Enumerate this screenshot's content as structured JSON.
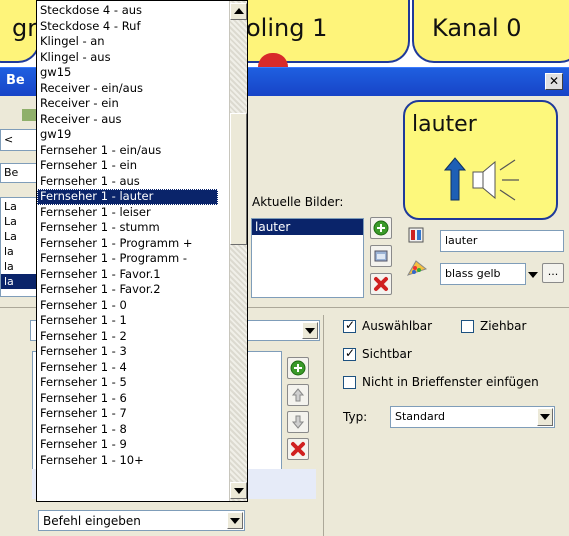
{
  "top_tabs": [
    {
      "label": "gr"
    },
    {
      "label": "oling 1"
    },
    {
      "label": "Kanal 0"
    }
  ],
  "dialog": {
    "title": "Be",
    "close_label": "✕"
  },
  "preview_tile": {
    "label": "lauter",
    "bg_color": "#fdf87c",
    "border_color": "#1f3a9a"
  },
  "left_stubs": {
    "nav_label": "<",
    "field_label": "Be",
    "list_items": [
      "La",
      "La",
      "La",
      "la",
      "la",
      "la"
    ]
  },
  "images": {
    "label": "Aktuelle Bilder:",
    "items": [
      "lauter"
    ]
  },
  "properties": {
    "text_value": "lauter",
    "color_value": "blass gelb",
    "more_button": "..."
  },
  "options": {
    "selectable": "Auswählbar",
    "draggable": "Ziehbar",
    "visible": "Sichtbar",
    "not_in_letter": "Nicht in Brieffenster einfügen",
    "type_label": "Typ:",
    "type_value": "Standard"
  },
  "lower_left": {
    "combo_value": "B"
  },
  "dropdown": {
    "items": [
      "Steckdose 4 - aus",
      "Steckdose 4 - Ruf",
      "Klingel - an",
      "Klingel - aus",
      "gw15",
      "Receiver - ein/aus",
      "Receiver - ein",
      "Receiver - aus",
      "gw19",
      "Fernseher 1 - ein/aus",
      "Fernseher 1 - ein",
      "Fernseher 1 - aus",
      "Fernseher 1 - lauter",
      "Fernseher 1 - leiser",
      "Fernseher 1 - stumm",
      "Fernseher 1 - Programm +",
      "Fernseher 1 - Programm -",
      "Fernseher 1 - Favor.1",
      "Fernseher 1 - Favor.2",
      "Fernseher 1 - 0",
      "Fernseher 1 - 1",
      "Fernseher 1 - 2",
      "Fernseher 1 - 3",
      "Fernseher 1 - 4",
      "Fernseher 1 - 5",
      "Fernseher 1 - 6",
      "Fernseher 1 - 7",
      "Fernseher 1 - 8",
      "Fernseher 1 - 9",
      "Fernseher 1 - 10+"
    ],
    "selected_index": 12,
    "scroll_position_fraction": 0.28,
    "selection_color": "#0a246a"
  },
  "command_combo": {
    "value": "Befehl eingeben"
  },
  "icons": {
    "add": "add-icon",
    "remove": "remove-icon",
    "up": "arrow-up-icon",
    "down": "arrow-down-icon",
    "speaker": "speaker-louder-icon"
  }
}
